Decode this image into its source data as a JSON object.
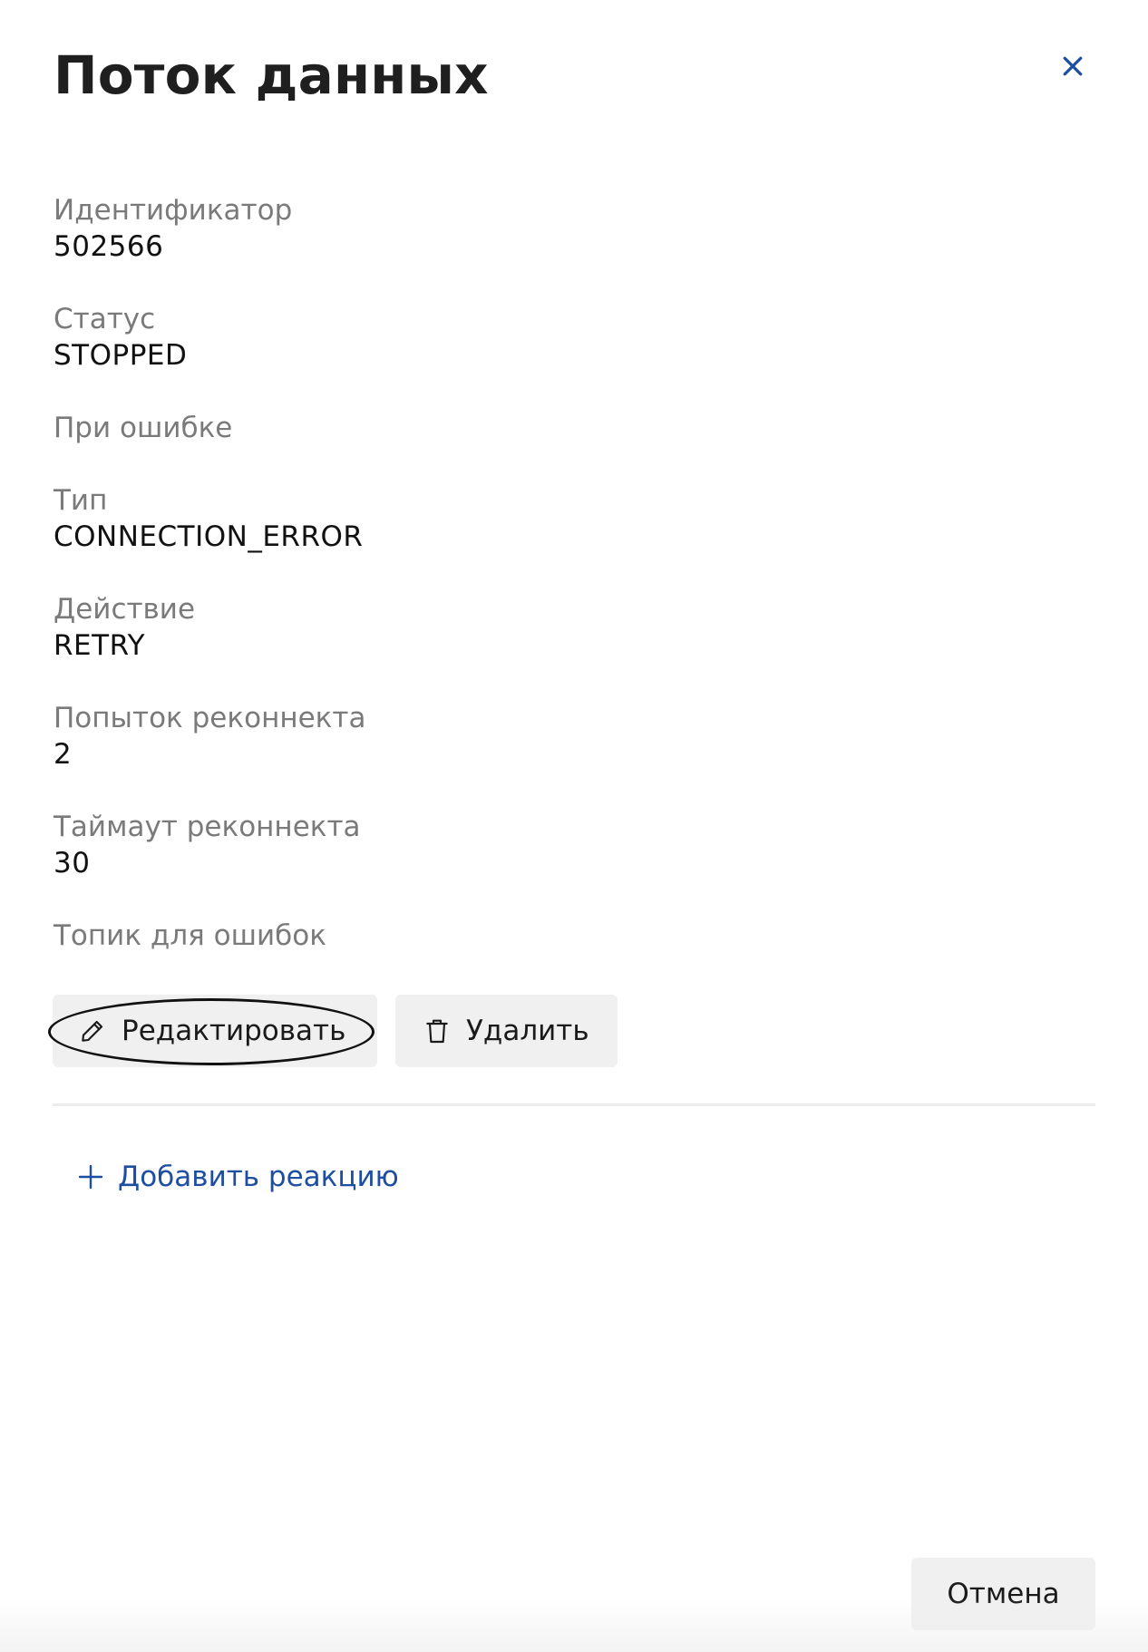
{
  "header": {
    "title": "Поток данных"
  },
  "fields": {
    "id_label": "Идентификатор",
    "id_value": "502566",
    "status_label": "Статус",
    "status_value": "STOPPED",
    "on_error_label": "При ошибке",
    "type_label": "Тип",
    "type_value": "CONNECTION_ERROR",
    "action_label": "Действие",
    "action_value": "RETRY",
    "reconnect_attempts_label": "Попыток реконнекта",
    "reconnect_attempts_value": "2",
    "reconnect_timeout_label": "Таймаут реконнекта",
    "reconnect_timeout_value": "30",
    "error_topic_label": "Топик для ошибок"
  },
  "actions": {
    "edit_label": "Редактировать",
    "delete_label": "Удалить"
  },
  "reactions": {
    "add_label": "Добавить реакцию"
  },
  "footer": {
    "cancel_label": "Отмена"
  },
  "icons": {
    "close": "close-icon",
    "edit": "pencil-icon",
    "delete": "trash-icon",
    "add": "plus-icon"
  },
  "colors": {
    "accent": "#1e4ea1",
    "label": "#7a7a7a",
    "button_bg": "#f0f0f0"
  }
}
